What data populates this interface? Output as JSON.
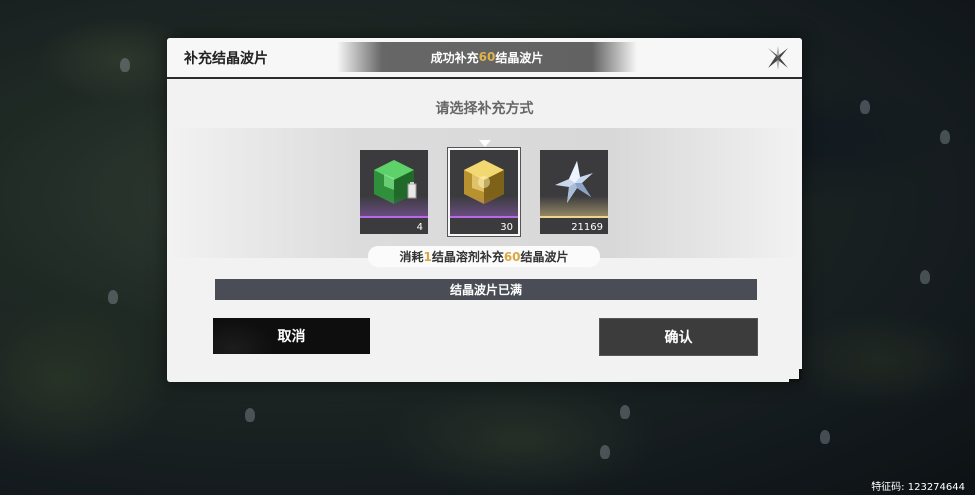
{
  "dialog": {
    "title": "补充结晶波片",
    "toast": {
      "prefix": "成功补充",
      "amount": "60",
      "suffix": "结晶波片"
    },
    "subtitle": "请选择补充方式",
    "items": [
      {
        "icon": "green-crystal-cube-icon",
        "count": "4",
        "rarity_color": "#b86ae6"
      },
      {
        "icon": "gold-crystal-cube-icon",
        "count": "30",
        "rarity_color": "#b86ae6",
        "selected": true
      },
      {
        "icon": "silver-star-crystal-icon",
        "count": "21169",
        "rarity_color": "#efd58a"
      }
    ],
    "description": {
      "part1": "消耗",
      "num1": "1",
      "part2": "结晶溶剂补充",
      "num2": "60",
      "part3": "结晶波片"
    },
    "status": "结晶波片已满",
    "cancel_label": "取消",
    "confirm_label": "确认",
    "highlight_color": "#d9a843"
  },
  "footer": {
    "uid": "特征码: 123274644"
  }
}
